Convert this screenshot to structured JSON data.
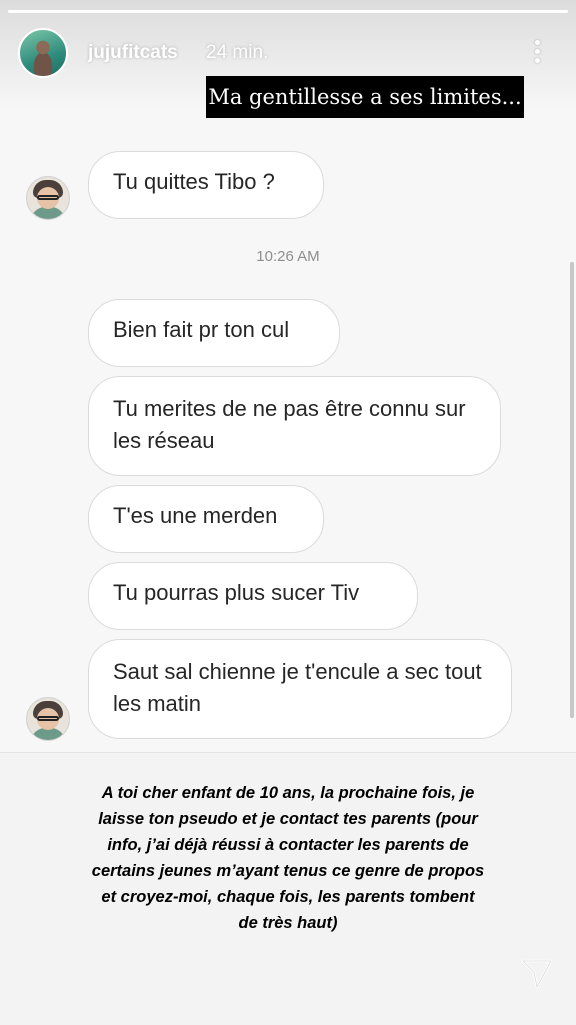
{
  "story": {
    "username": "jujufitcats",
    "time_ago": "24 min.",
    "caption": "Ma gentillesse a ses limites...",
    "progress": 1.0
  },
  "chat": {
    "messages": [
      "Tu quittes Tibo ?",
      "Bien fait pr ton cul",
      "Tu merites de ne pas être connu sur les réseau",
      "T'es une merden",
      "Tu pourras plus sucer Tiv",
      "Saut sal chienne je t'encule a sec tout les matin"
    ],
    "timestamp": "10:26 AM"
  },
  "note": {
    "text": "A toi cher enfant de 10 ans, la prochaine fois, je laisse ton pseudo et je contact tes parents (pour info, j’ai déjà réussi à contacter les parents de certains jeunes m’ayant tenus ce genre de propos et croyez-moi, chaque fois, les parents tombent de très haut)"
  },
  "icons": {
    "more": "more-options-icon",
    "send": "send-icon"
  }
}
